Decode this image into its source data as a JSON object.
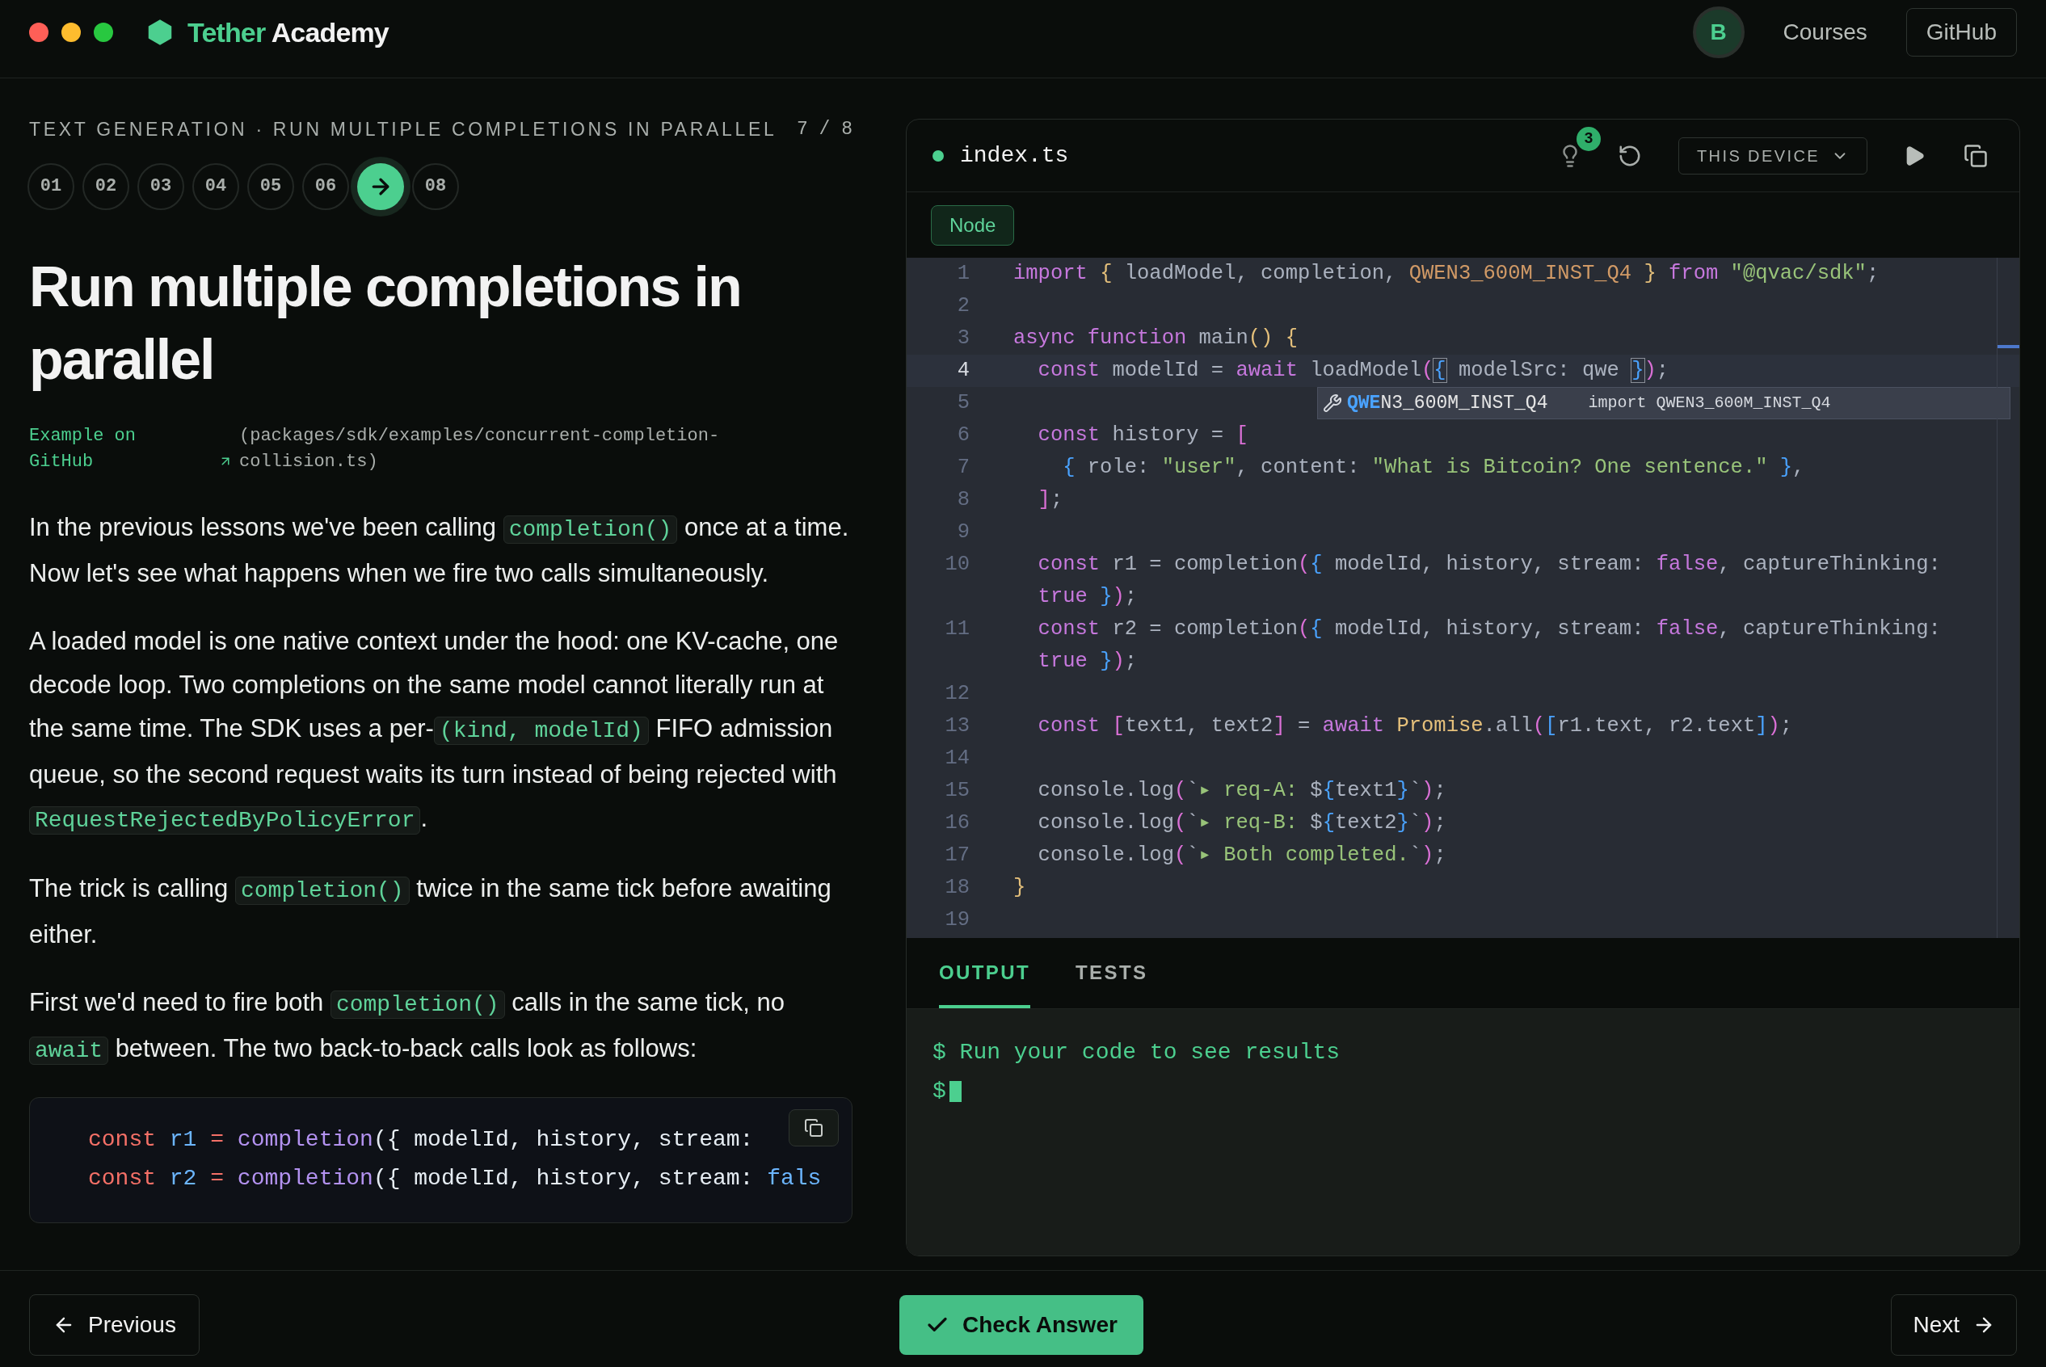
{
  "brand": {
    "accent": "Tether",
    "rest": "Academy"
  },
  "nav": {
    "avatar": "B",
    "courses_link": "Courses",
    "github_button": "GitHub"
  },
  "lesson": {
    "breadcrumb": "TEXT GENERATION · RUN MULTIPLE COMPLETIONS IN PARALLEL",
    "progress": "7 / 8",
    "steps": [
      {
        "label": "01",
        "selected": false
      },
      {
        "label": "02",
        "selected": false
      },
      {
        "label": "03",
        "selected": false
      },
      {
        "label": "04",
        "selected": false
      },
      {
        "label": "05",
        "selected": false
      },
      {
        "label": "06",
        "selected": false
      },
      {
        "selected": true
      },
      {
        "label": "08",
        "selected": false
      }
    ],
    "title": "Run multiple completions in parallel",
    "source_link": "Example on GitHub",
    "source_path": "(packages/sdk/examples/concurrent-completion-collision.ts)",
    "paragraphs": [
      [
        {
          "kind": "text",
          "text": "In the previous lessons we've been calling "
        },
        {
          "kind": "code",
          "text": "completion()"
        },
        {
          "kind": "text",
          "text": " once at a time. Now let's see what happens when we fire two calls simultaneously."
        }
      ],
      [
        {
          "kind": "text",
          "text": "A loaded model is one native context under the hood: one KV-cache, one decode loop. Two completions on the same model cannot literally run at the same time. The SDK uses a per-"
        },
        {
          "kind": "code",
          "text": "(kind, modelId)"
        },
        {
          "kind": "text",
          "text": " FIFO admission queue, so the second request waits its turn instead of being rejected with "
        },
        {
          "kind": "code",
          "text": "RequestRejectedByPolicyError"
        },
        {
          "kind": "text",
          "text": "."
        }
      ],
      [
        {
          "kind": "text",
          "text": "The trick is calling "
        },
        {
          "kind": "code",
          "text": "completion()"
        },
        {
          "kind": "text",
          "text": " twice in the same tick before awaiting either."
        }
      ],
      [
        {
          "kind": "text",
          "text": "First we'd need to fire both "
        },
        {
          "kind": "code",
          "text": "completion()"
        },
        {
          "kind": "text",
          "text": " calls in the same tick, no "
        },
        {
          "kind": "code",
          "text": "await"
        },
        {
          "kind": "text",
          "text": " between. The two back-to-back calls look as follows:"
        }
      ]
    ],
    "code_block": [
      [
        {
          "kind": "kw",
          "text": "const"
        },
        {
          "kind": "var",
          "text": " r1"
        },
        {
          "kind": "kw",
          "text": " ="
        },
        {
          "kind": "fn",
          "text": " completion"
        },
        {
          "kind": "plain",
          "text": "({ modelId, history, stream:"
        }
      ],
      [
        {
          "kind": "kw",
          "text": "const"
        },
        {
          "kind": "var",
          "text": " r2"
        },
        {
          "kind": "kw",
          "text": " ="
        },
        {
          "kind": "fn",
          "text": " completion"
        },
        {
          "kind": "plain",
          "text": "({ modelId, history, stream:"
        },
        {
          "kind": "var",
          "text": " fals"
        }
      ]
    ]
  },
  "editor": {
    "filename": "index.ts",
    "hints_badge": "3",
    "runtime_select": "THIS DEVICE",
    "runtime_tag": "Node",
    "lines": [
      {
        "number": "1",
        "current": false,
        "tokens": [
          {
            "kind": "kw",
            "text": "import"
          },
          {
            "kind": "b1",
            "text": " {"
          },
          {
            "kind": "plain",
            "text": " loadModel, completion,"
          },
          {
            "kind": "const",
            "text": " QWEN3_600M_INST_Q4"
          },
          {
            "kind": "b1",
            "text": " }"
          },
          {
            "kind": "kw",
            "text": " from"
          },
          {
            "kind": "str",
            "text": " \"@qvac/sdk\""
          },
          {
            "kind": "plain",
            "text": ";"
          }
        ]
      },
      {
        "number": "2",
        "current": false
      },
      {
        "number": "3",
        "current": false,
        "tokens": [
          {
            "kind": "kw",
            "text": "async function"
          },
          {
            "kind": "plain",
            "text": " main"
          },
          {
            "kind": "b1",
            "text": "()"
          },
          {
            "kind": "b1",
            "text": " {"
          }
        ]
      },
      {
        "number": "4",
        "current": true,
        "tokens": [
          {
            "kind": "kw",
            "text": "  const"
          },
          {
            "kind": "plain",
            "text": " modelId ="
          },
          {
            "kind": "kw",
            "text": " await"
          },
          {
            "kind": "plain",
            "text": " loadModel"
          },
          {
            "kind": "b2",
            "text": "("
          },
          {
            "kind": "match",
            "text": "{"
          },
          {
            "kind": "plain",
            "text": " modelSrc: qwe "
          },
          {
            "kind": "match",
            "text": "}"
          },
          {
            "kind": "b2",
            "text": ")"
          },
          {
            "kind": "plain",
            "text": ";"
          }
        ]
      },
      {
        "number": "5",
        "current": false
      },
      {
        "number": "6",
        "current": false,
        "tokens": [
          {
            "kind": "kw",
            "text": "  const"
          },
          {
            "kind": "plain",
            "text": " history ="
          },
          {
            "kind": "b2",
            "text": " ["
          }
        ]
      },
      {
        "number": "7",
        "current": false,
        "tokens": [
          {
            "kind": "b3",
            "text": "    {"
          },
          {
            "kind": "plain",
            "text": " role:"
          },
          {
            "kind": "str",
            "text": " \"user\""
          },
          {
            "kind": "plain",
            "text": ", content:"
          },
          {
            "kind": "str",
            "text": " \"What is Bitcoin? One sentence.\""
          },
          {
            "kind": "b3",
            "text": " }"
          },
          {
            "kind": "plain",
            "text": ","
          }
        ]
      },
      {
        "number": "8",
        "current": false,
        "tokens": [
          {
            "kind": "b2",
            "text": "  ]"
          },
          {
            "kind": "plain",
            "text": ";"
          }
        ]
      },
      {
        "number": "9",
        "current": false
      },
      {
        "number": "10",
        "current": false,
        "tokens": [
          {
            "kind": "kw",
            "text": "  const"
          },
          {
            "kind": "plain",
            "text": " r1 = completion"
          },
          {
            "kind": "b2",
            "text": "("
          },
          {
            "kind": "b3",
            "text": "{"
          },
          {
            "kind": "plain",
            "text": " modelId, history, stream:"
          },
          {
            "kind": "kw",
            "text": " false"
          },
          {
            "kind": "plain",
            "text": ", captureThinking:"
          }
        ],
        "continuation": [
          {
            "kind": "kw",
            "text": "  true"
          },
          {
            "kind": "b3",
            "text": " }"
          },
          {
            "kind": "b2",
            "text": ")"
          },
          {
            "kind": "plain",
            "text": ";"
          }
        ]
      },
      {
        "number": "11",
        "current": false,
        "tokens": [
          {
            "kind": "kw",
            "text": "  const"
          },
          {
            "kind": "plain",
            "text": " r2 = completion"
          },
          {
            "kind": "b2",
            "text": "("
          },
          {
            "kind": "b3",
            "text": "{"
          },
          {
            "kind": "plain",
            "text": " modelId, history, stream:"
          },
          {
            "kind": "kw",
            "text": " false"
          },
          {
            "kind": "plain",
            "text": ", captureThinking:"
          }
        ],
        "continuation": [
          {
            "kind": "kw",
            "text": "  true"
          },
          {
            "kind": "b3",
            "text": " }"
          },
          {
            "kind": "b2",
            "text": ")"
          },
          {
            "kind": "plain",
            "text": ";"
          }
        ]
      },
      {
        "number": "12",
        "current": false
      },
      {
        "number": "13",
        "current": false,
        "tokens": [
          {
            "kind": "kw",
            "text": "  const"
          },
          {
            "kind": "b2",
            "text": " ["
          },
          {
            "kind": "plain",
            "text": "text1, text2"
          },
          {
            "kind": "b2",
            "text": "]"
          },
          {
            "kind": "plain",
            "text": " ="
          },
          {
            "kind": "kw",
            "text": " await"
          },
          {
            "kind": "b1",
            "text": " Promise"
          },
          {
            "kind": "plain",
            "text": ".all"
          },
          {
            "kind": "b2",
            "text": "("
          },
          {
            "kind": "b3",
            "text": "["
          },
          {
            "kind": "plain",
            "text": "r1.text, r2.text"
          },
          {
            "kind": "b3",
            "text": "]"
          },
          {
            "kind": "b2",
            "text": ")"
          },
          {
            "kind": "plain",
            "text": ";"
          }
        ]
      },
      {
        "number": "14",
        "current": false
      },
      {
        "number": "15",
        "current": false,
        "tokens": [
          {
            "kind": "plain",
            "text": "  console.log"
          },
          {
            "kind": "b2",
            "text": "("
          },
          {
            "kind": "plain",
            "text": "`"
          },
          {
            "kind": "str",
            "text": "▸ req-A: "
          },
          {
            "kind": "plain",
            "text": "$"
          },
          {
            "kind": "b3",
            "text": "{"
          },
          {
            "kind": "plain",
            "text": "text1"
          },
          {
            "kind": "b3",
            "text": "}"
          },
          {
            "kind": "plain",
            "text": "`"
          },
          {
            "kind": "b2",
            "text": ")"
          },
          {
            "kind": "plain",
            "text": ";"
          }
        ]
      },
      {
        "number": "16",
        "current": false,
        "tokens": [
          {
            "kind": "plain",
            "text": "  console.log"
          },
          {
            "kind": "b2",
            "text": "("
          },
          {
            "kind": "plain",
            "text": "`"
          },
          {
            "kind": "str",
            "text": "▸ req-B: "
          },
          {
            "kind": "plain",
            "text": "$"
          },
          {
            "kind": "b3",
            "text": "{"
          },
          {
            "kind": "plain",
            "text": "text2"
          },
          {
            "kind": "b3",
            "text": "}"
          },
          {
            "kind": "plain",
            "text": "`"
          },
          {
            "kind": "b2",
            "text": ")"
          },
          {
            "kind": "plain",
            "text": ";"
          }
        ]
      },
      {
        "number": "17",
        "current": false,
        "tokens": [
          {
            "kind": "plain",
            "text": "  console.log"
          },
          {
            "kind": "b2",
            "text": "("
          },
          {
            "kind": "plain",
            "text": "`"
          },
          {
            "kind": "str",
            "text": "▸ Both completed."
          },
          {
            "kind": "plain",
            "text": "`"
          },
          {
            "kind": "b2",
            "text": ")"
          },
          {
            "kind": "plain",
            "text": ";"
          }
        ]
      },
      {
        "number": "18",
        "current": false,
        "tokens": [
          {
            "kind": "b1",
            "text": "}"
          }
        ]
      },
      {
        "number": "19",
        "current": false
      }
    ],
    "autocomplete": {
      "label": "**QWE**N3_600M_INST_Q4",
      "detail": "import QWEN3_600M_INST_Q4"
    },
    "output_tabs": [
      {
        "label": "OUTPUT",
        "selected": true
      },
      {
        "label": "TESTS",
        "selected": false
      }
    ],
    "output_lines": [
      "$ Run your code to see results",
      "$"
    ]
  },
  "footer": {
    "previous_button": "Previous",
    "check_button": "Check Answer",
    "next_button": "Next"
  }
}
